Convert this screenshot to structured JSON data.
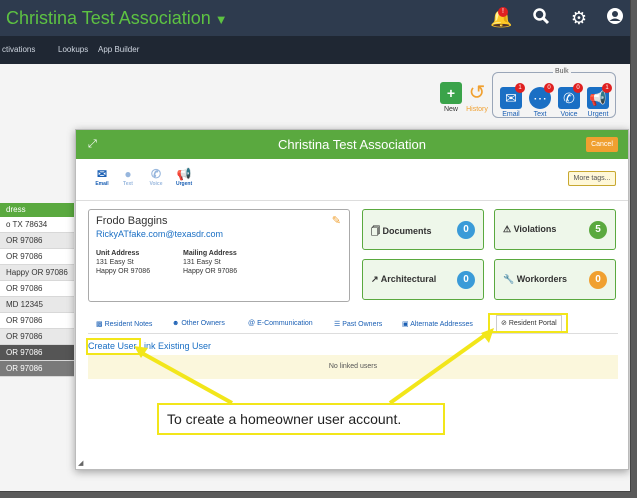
{
  "header": {
    "title": "Christina Test Association"
  },
  "subnav": [
    "ctivations",
    "Lookups",
    "App Builder"
  ],
  "toolbar": {
    "new_label": "New",
    "history_label": "History",
    "bulk_label": "Bulk",
    "email_label": "Email",
    "text_label": "Text",
    "voice_label": "Voice",
    "urgent_label": "Urgent",
    "email_badge": "1",
    "text_badge": "0",
    "voice_badge": "0",
    "urgent_badge": "1"
  },
  "left_table": {
    "header": "dress",
    "rows": [
      "o TX 78634",
      "OR 97086",
      "OR 97086",
      "Happy OR 97086",
      "OR 97086",
      "MD 12345",
      "OR 97086",
      "OR 97086",
      "OR 97086",
      "OR 97086"
    ]
  },
  "modal": {
    "title": "Christina Test Association",
    "cancel_label": "Cancel",
    "tools": {
      "email": "Email",
      "text": "Text",
      "voice": "Voice",
      "urgent": "Urgent"
    },
    "more_tags": "More tags...",
    "owner": {
      "name": "Frodo Baggins",
      "email": "RickyATfake.com@texasdr.com",
      "unit_address_label": "Unit Address",
      "unit_address_line1": "131 Easy St",
      "unit_address_line2": "Happy OR 97086",
      "mailing_address_label": "Mailing Address",
      "mailing_address_line1": "131 Easy St",
      "mailing_address_line2": "Happy OR 97086"
    },
    "cards": {
      "documents": {
        "label": "Documents",
        "count": "0"
      },
      "violations": {
        "label": "Violations",
        "count": "5"
      },
      "architectural": {
        "label": "Architectural",
        "count": "0"
      },
      "workorders": {
        "label": "Workorders",
        "count": "0"
      }
    },
    "tabs": {
      "resident_notes": "Resident Notes",
      "other_owners": "Other Owners",
      "e_communication": "E-Communication",
      "past_owners": "Past Owners",
      "alternate_addresses": "Alternate Addresses",
      "resident_portal": "Resident Portal"
    },
    "portal": {
      "create_user": "Create User",
      "link_existing_user": "Link Existing User",
      "no_linked": "No linked users"
    }
  },
  "callout": {
    "text": "To create a homeowner user account."
  },
  "colors": {
    "green": "#5aa93f",
    "navy": "#2e3b4e",
    "highlight": "#f2e61a",
    "orange": "#f0a030",
    "blue": "#1a6fc4"
  }
}
